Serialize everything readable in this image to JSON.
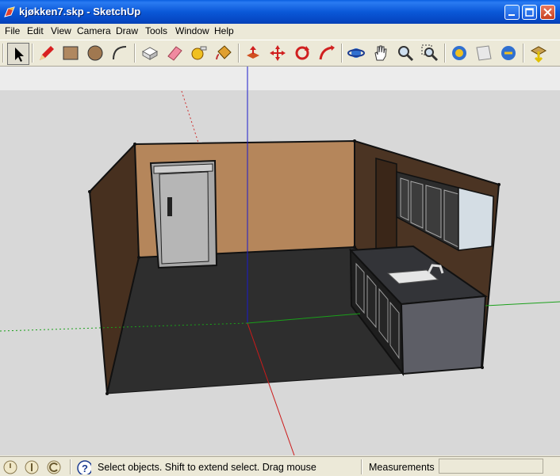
{
  "window": {
    "title": "kjøkken7.skp - SketchUp"
  },
  "menu": {
    "items": [
      "File",
      "Edit",
      "View",
      "Camera",
      "Draw",
      "Tools",
      "Window",
      "Help"
    ]
  },
  "toolbar": {
    "tools": [
      "select-icon",
      "pencil-icon",
      "rectangle-icon",
      "circle-icon",
      "arc-icon",
      "make-component-icon",
      "eraser-icon",
      "tape-measure-icon",
      "paint-bucket-icon",
      "push-pull-icon",
      "move-icon",
      "rotate-icon",
      "follow-me-icon",
      "orbit-icon",
      "pan-icon",
      "zoom-icon",
      "zoom-window-icon",
      "zoom-extents-icon",
      "previous-view-icon",
      "next-view-icon",
      "get-models-icon"
    ]
  },
  "status": {
    "hint": "Select objects. Shift to extend select. Drag mouse",
    "measurements_label": "Measurements",
    "measurements_value": ""
  },
  "colors": {
    "titlebar": "#0a58d8",
    "chrome": "#ece9d8",
    "back_wall": "#b5865b",
    "side_wall": "#4a3222",
    "floor": "#2f2f2f",
    "axis_blue": "#1a1acc",
    "axis_red": "#cc1a1a",
    "axis_green": "#1aa01a"
  }
}
